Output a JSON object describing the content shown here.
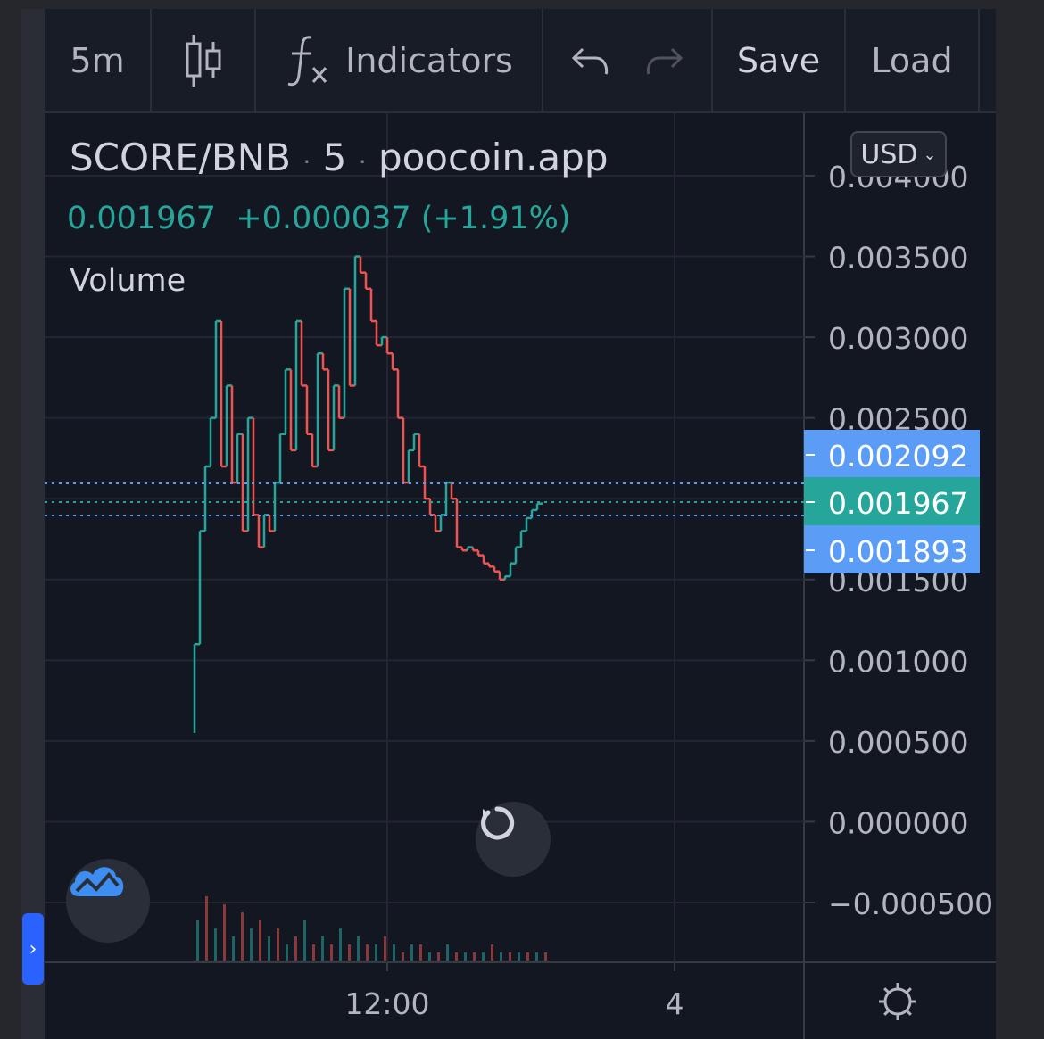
{
  "toolbar": {
    "interval": "5m",
    "indicators_label": "Indicators",
    "save_label": "Save",
    "load_label": "Load"
  },
  "legend": {
    "symbol": "SCORE/BNB",
    "interval": "5",
    "source": "poocoin.app",
    "separator": "·",
    "last": "0.001967",
    "change": "+0.000037",
    "change_pct": "(+1.91%)",
    "volume_label": "Volume"
  },
  "currency": "USD",
  "colors": {
    "up": "#26a69a",
    "down": "#ef5350",
    "highlight": "#5b9cf6",
    "price_tag": "#26a69a"
  },
  "price_axis": {
    "ticks": [
      "0.004000",
      "0.003500",
      "0.003000",
      "0.002500",
      "0.002000",
      "0.001500",
      "0.001000",
      "0.000500",
      "0.000000",
      "−0.000500"
    ],
    "tags": [
      {
        "value": "0.002092",
        "kind": "highlight"
      },
      {
        "value": "0.001967",
        "kind": "last"
      },
      {
        "value": "0.001893",
        "kind": "highlight"
      }
    ]
  },
  "time_axis": {
    "ticks": [
      "12:00",
      "4"
    ]
  },
  "chart_data": {
    "type": "line",
    "title": "SCORE/BNB · 5 · poocoin.app",
    "ylim": [
      -0.0005,
      0.004
    ],
    "price": [
      [
        0,
        0.00055
      ],
      [
        2,
        0.0011
      ],
      [
        4,
        0.0018
      ],
      [
        6,
        0.0022
      ],
      [
        8,
        0.0025
      ],
      [
        10,
        0.0031
      ],
      [
        12,
        0.0022
      ],
      [
        14,
        0.0027
      ],
      [
        16,
        0.0021
      ],
      [
        18,
        0.0024
      ],
      [
        20,
        0.0018
      ],
      [
        22,
        0.0025
      ],
      [
        24,
        0.0019
      ],
      [
        26,
        0.0017
      ],
      [
        28,
        0.0019
      ],
      [
        30,
        0.0018
      ],
      [
        32,
        0.0021
      ],
      [
        34,
        0.0024
      ],
      [
        36,
        0.0028
      ],
      [
        38,
        0.0023
      ],
      [
        40,
        0.0031
      ],
      [
        42,
        0.0027
      ],
      [
        44,
        0.0024
      ],
      [
        46,
        0.0022
      ],
      [
        48,
        0.0029
      ],
      [
        50,
        0.0028
      ],
      [
        52,
        0.0023
      ],
      [
        54,
        0.0027
      ],
      [
        56,
        0.0025
      ],
      [
        58,
        0.0033
      ],
      [
        60,
        0.0027
      ],
      [
        62,
        0.0035
      ],
      [
        64,
        0.0034
      ],
      [
        66,
        0.0033
      ],
      [
        68,
        0.0031
      ],
      [
        70,
        0.00295
      ],
      [
        72,
        0.003
      ],
      [
        74,
        0.0029
      ],
      [
        76,
        0.0028
      ],
      [
        78,
        0.0025
      ],
      [
        80,
        0.0021
      ],
      [
        82,
        0.0023
      ],
      [
        84,
        0.0024
      ],
      [
        86,
        0.0022
      ],
      [
        88,
        0.002
      ],
      [
        90,
        0.0019
      ],
      [
        92,
        0.0018
      ],
      [
        94,
        0.0019
      ],
      [
        96,
        0.0021
      ],
      [
        98,
        0.002
      ],
      [
        100,
        0.0017
      ],
      [
        102,
        0.00168
      ],
      [
        104,
        0.0017
      ],
      [
        106,
        0.00168
      ],
      [
        108,
        0.00165
      ],
      [
        110,
        0.0016
      ],
      [
        112,
        0.00158
      ],
      [
        114,
        0.00155
      ],
      [
        116,
        0.0015
      ],
      [
        118,
        0.00152
      ],
      [
        120,
        0.0016
      ],
      [
        122,
        0.0017
      ],
      [
        124,
        0.0018
      ],
      [
        126,
        0.00188
      ],
      [
        128,
        0.00193
      ],
      [
        130,
        0.00197
      ]
    ],
    "volume": [
      5,
      8,
      4,
      7,
      3,
      6,
      4,
      5,
      3,
      4,
      2,
      3,
      5,
      2,
      3,
      2,
      4,
      2,
      3,
      2,
      2,
      3,
      2,
      1,
      2,
      2,
      1,
      1,
      2,
      1,
      1,
      1,
      1,
      2,
      1,
      1,
      1,
      1,
      1,
      1
    ],
    "markers": {
      "last_price": 0.001967,
      "lines": [
        0.002092,
        0.001893
      ]
    }
  }
}
